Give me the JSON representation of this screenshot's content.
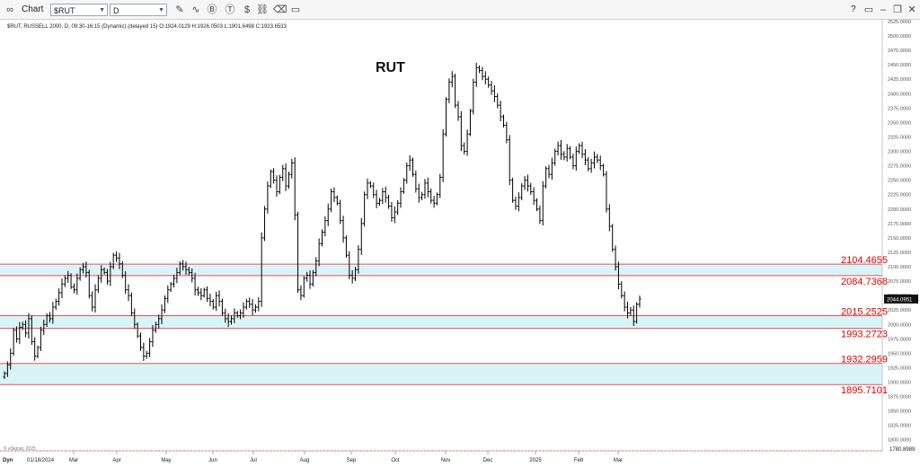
{
  "toolbar": {
    "app_label": "Chart",
    "symbol_value": "$RUT",
    "interval_value": "D",
    "help_label": "?"
  },
  "chart_data": {
    "type": "ohlc",
    "title": "RUT",
    "info_line": "$RUT, RUSSELL 2000, D, 09:30-16:15 (Dynamic) (delayed 15) O:1924.0129 H:1926.0503 L:1901.6498 C:1923.6533",
    "copyright": "© eSignal, 2025",
    "start_date_label": "01/18/2024",
    "corner_label": "Dyn",
    "ylim": [
      1780.8989,
      2525
    ],
    "y_ticks": [
      1800,
      1825,
      1850,
      1875,
      1900,
      1925,
      1950,
      1975,
      2000,
      2025,
      2050,
      2075,
      2100,
      2125,
      2150,
      2175,
      2200,
      2225,
      2250,
      2275,
      2300,
      2325,
      2350,
      2375,
      2400,
      2425,
      2450,
      2475,
      2500,
      2525
    ],
    "y_min_label": "1780.8989",
    "last_price": 2044.0951,
    "last_price_label": "2044.0951",
    "x_labels": [
      "Mar",
      "Apr",
      "May",
      "Jun",
      "Jul",
      "Aug",
      "Sep",
      "Oct",
      "Nov",
      "Dec",
      "2025",
      "Feb",
      "Mar"
    ],
    "zones": [
      {
        "upper": 2104.4655,
        "lower": 2084.7368,
        "upper_label": "2104.4655",
        "lower_label": "2084.7368"
      },
      {
        "upper": 2015.2525,
        "lower": 1993.2723,
        "upper_label": "2015.2525",
        "lower_label": "1993.2723"
      },
      {
        "upper": 1932.2959,
        "lower": 1895.7101,
        "upper_label": "1932.2959",
        "lower_label": "1895.7101"
      }
    ],
    "zone_line_color": "#e8505b",
    "zone_fill_color": "#d8f4f6",
    "zone_label_color": "#e00000",
    "bar_color": "#000000",
    "closes": [
      1915,
      1930,
      1950,
      1990,
      1975,
      1995,
      2000,
      1985,
      2010,
      1970,
      1945,
      1960,
      1990,
      2000,
      2015,
      2010,
      2030,
      2040,
      2055,
      2070,
      2080,
      2085,
      2065,
      2060,
      2080,
      2095,
      2100,
      2090,
      2050,
      2030,
      2060,
      2080,
      2095,
      2090,
      2075,
      2100,
      2120,
      2115,
      2105,
      2085,
      2060,
      2050,
      2020,
      2000,
      1980,
      1960,
      1945,
      1950,
      1970,
      1990,
      2000,
      2010,
      2025,
      2045,
      2060,
      2070,
      2080,
      2090,
      2105,
      2100,
      2095,
      2090,
      2080,
      2060,
      2055,
      2050,
      2060,
      2045,
      2040,
      2030,
      2050,
      2040,
      2020,
      2010,
      2005,
      2010,
      2020,
      2015,
      2020,
      2030,
      2040,
      2035,
      2025,
      2030,
      2040,
      2150,
      2200,
      2240,
      2265,
      2250,
      2230,
      2255,
      2270,
      2240,
      2260,
      2280,
      2190,
      2060,
      2050,
      2080,
      2085,
      2070,
      2090,
      2110,
      2140,
      2160,
      2180,
      2200,
      2230,
      2220,
      2210,
      2180,
      2150,
      2120,
      2085,
      2080,
      2095,
      2130,
      2175,
      2225,
      2245,
      2240,
      2225,
      2210,
      2215,
      2230,
      2220,
      2205,
      2185,
      2195,
      2210,
      2230,
      2250,
      2275,
      2285,
      2260,
      2235,
      2220,
      2225,
      2245,
      2230,
      2215,
      2210,
      2225,
      2255,
      2330,
      2390,
      2420,
      2430,
      2380,
      2360,
      2310,
      2300,
      2330,
      2370,
      2420,
      2445,
      2440,
      2430,
      2425,
      2415,
      2405,
      2395,
      2380,
      2360,
      2345,
      2320,
      2250,
      2215,
      2205,
      2220,
      2240,
      2250,
      2240,
      2230,
      2215,
      2200,
      2180,
      2240,
      2270,
      2260,
      2280,
      2300,
      2310,
      2295,
      2290,
      2305,
      2290,
      2275,
      2300,
      2310,
      2295,
      2285,
      2270,
      2280,
      2290,
      2285,
      2275,
      2260,
      2200,
      2170,
      2130,
      2100,
      2070,
      2050,
      2030,
      2020,
      2025,
      2005,
      2035,
      2044.1
    ]
  }
}
